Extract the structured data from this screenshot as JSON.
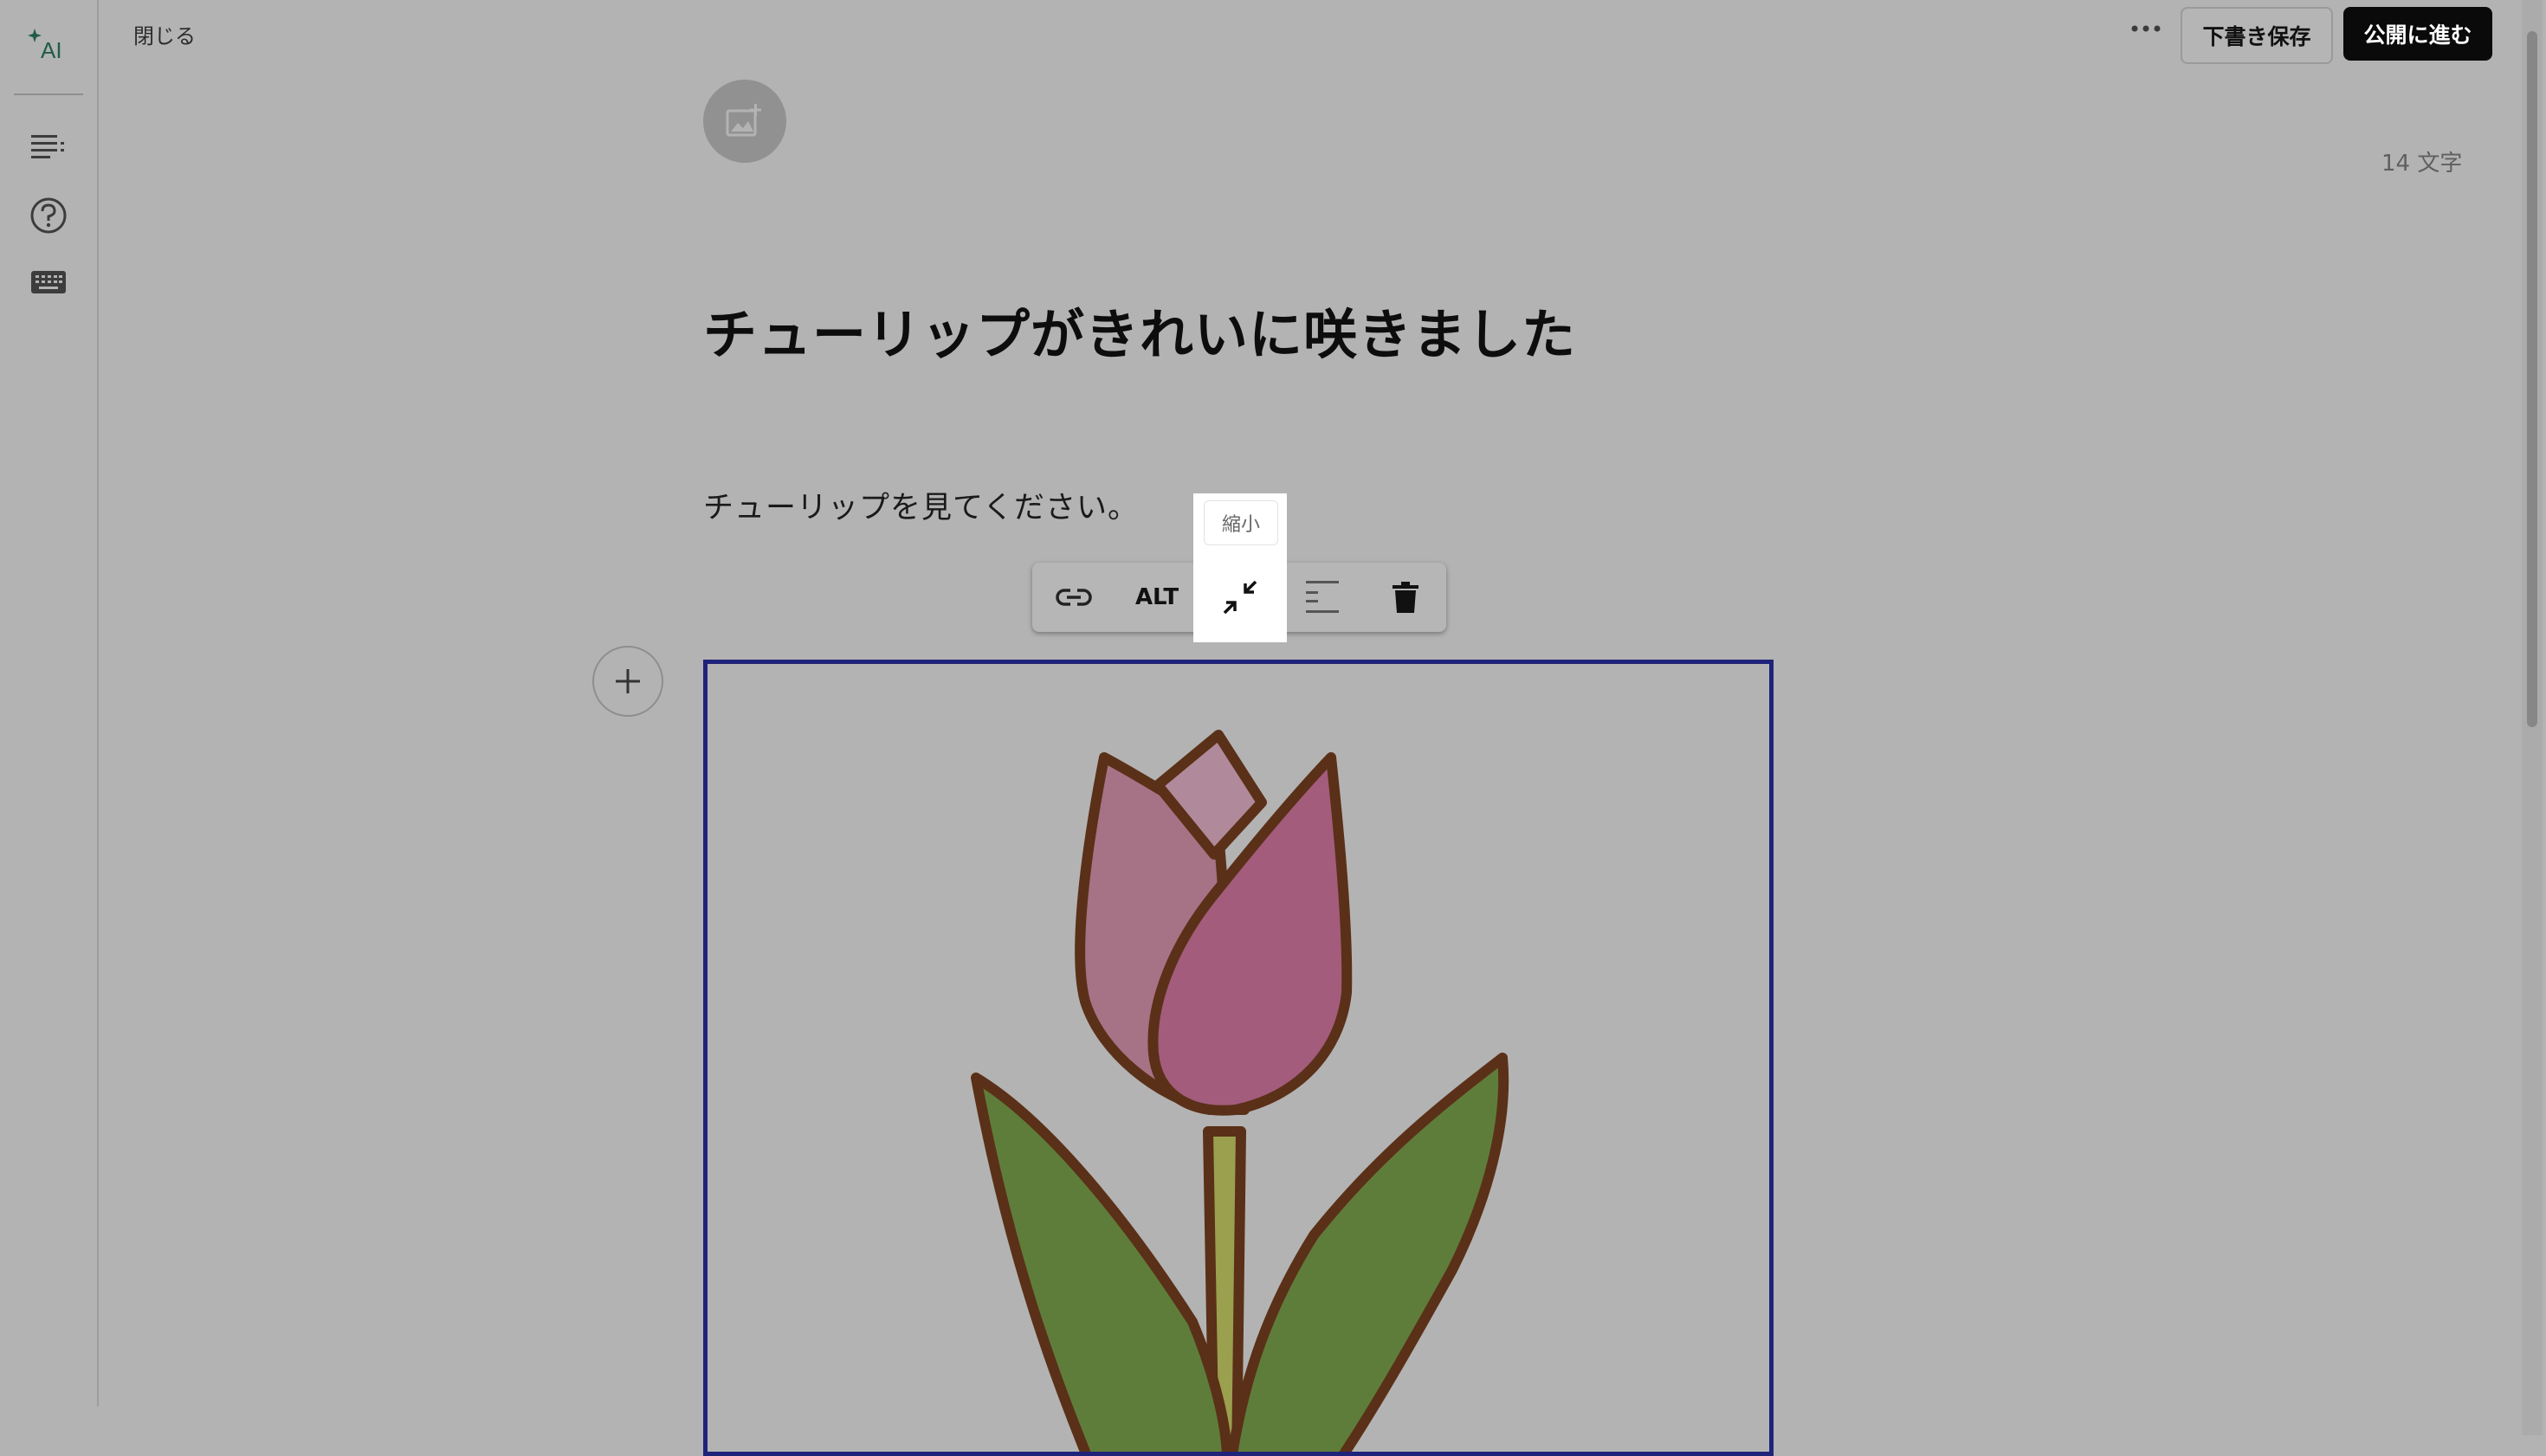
{
  "sidebar": {
    "ai_label": "AI",
    "items": [
      {
        "icon": "table-of-contents-icon"
      },
      {
        "icon": "help-icon"
      },
      {
        "icon": "keyboard-icon"
      }
    ]
  },
  "header": {
    "close_label": "閉じる",
    "more_icon": "more-icon",
    "draft_save_label": "下書き保存",
    "publish_label": "公開に進む"
  },
  "editor": {
    "char_count": "14 文字",
    "title": "チューリップがきれいに咲きました",
    "body": "チューリップを見てください。",
    "image_alt": "tulip illustration"
  },
  "image_toolbar": {
    "alt_label": "ALT",
    "tooltip": "縮小",
    "buttons": [
      "link-icon",
      "alt-button",
      "shrink-icon",
      "align-left-icon",
      "trash-icon"
    ]
  },
  "colors": {
    "overlay_bg": "#b3b3b3",
    "selection_border": "#20237a",
    "publish_bg": "#0a0a0a",
    "ai_accent": "#1f5c4a"
  }
}
